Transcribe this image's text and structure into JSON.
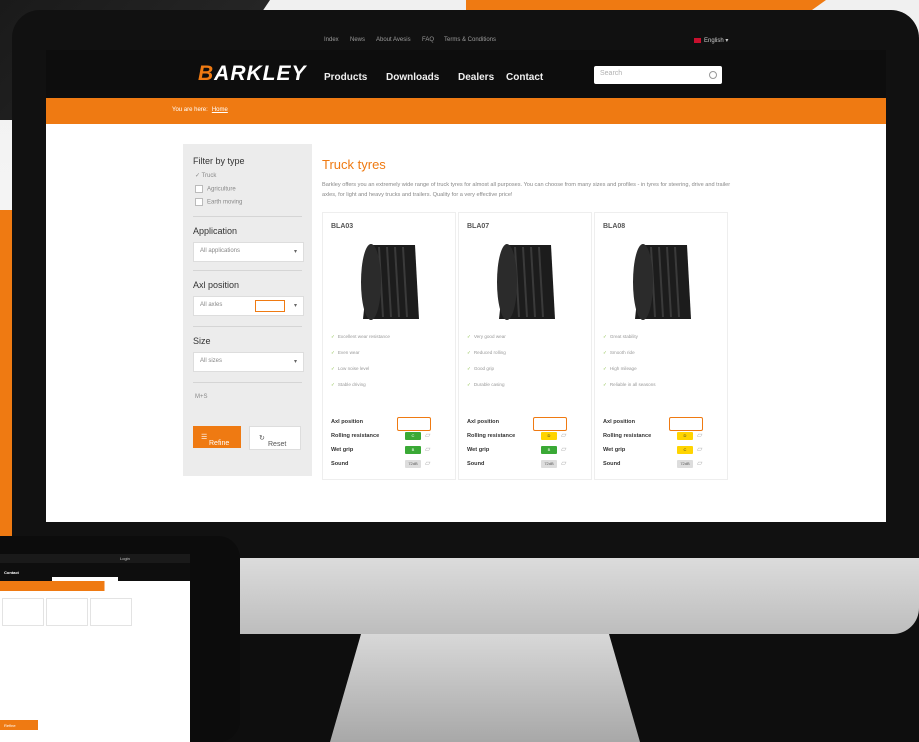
{
  "topbar": {
    "links": [
      "Index",
      "News",
      "About Avesis",
      "FAQ",
      "Terms & Conditions"
    ],
    "language": "English"
  },
  "header": {
    "logo_first": "B",
    "logo_rest": "ARKLEY",
    "nav": [
      "Products",
      "Downloads",
      "Dealers",
      "Contact"
    ],
    "search_placeholder": "Search"
  },
  "breadcrumb": {
    "prefix": "You are here:",
    "current": "Home"
  },
  "sidebar": {
    "filter_heading": "Filter by type",
    "types": [
      "Truck",
      "Agriculture",
      "Earth moving"
    ],
    "application_heading": "Application",
    "application_value": "All applications",
    "axle_heading": "Axl position",
    "axle_value": "All axles",
    "size_heading": "Size",
    "size_value": "All sizes",
    "extra_label": "M+S",
    "refine_label": "Refine",
    "reset_label": "Reset"
  },
  "content": {
    "title": "Truck tyres",
    "intro": "Barkley offers you an extremely wide range of truck tyres for almost all purposes. You can choose from many sizes and profiles - in tyres for steering, drive and trailer axles, for light and heavy trucks and trailers. Quality for a very effective price!"
  },
  "cards": [
    {
      "name": "BLA03",
      "bullets": [
        "Excellent wear resistance",
        "Even wear",
        "Low noise level",
        "Stable driving"
      ],
      "specs": {
        "axle": "Axl position",
        "rolling": "Rolling resistance",
        "wet": "Wet grip",
        "sound": "Sound"
      },
      "badges": {
        "rolling": "C",
        "wet": "B",
        "sound": "72dB"
      }
    },
    {
      "name": "BLA07",
      "bullets": [
        "Very good wear",
        "Reduced rolling",
        "Good grip",
        "Durable casing"
      ],
      "specs": {
        "axle": "Axl position",
        "rolling": "Rolling resistance",
        "wet": "Wet grip",
        "sound": "Sound"
      },
      "badges": {
        "rolling": "D",
        "wet": "B",
        "sound": "72dB"
      }
    },
    {
      "name": "BLA08",
      "bullets": [
        "Great stability",
        "Smooth ride",
        "High mileage",
        "Reliable in all seasons"
      ],
      "specs": {
        "axle": "Axl position",
        "rolling": "Rolling resistance",
        "wet": "Wet grip",
        "sound": "Sound"
      },
      "badges": {
        "rolling": "D",
        "wet": "C",
        "sound": "72dB"
      }
    }
  ],
  "tablet": {
    "menu": "Contact",
    "lang": "Login",
    "refine": "Refine"
  },
  "colors": {
    "accent": "#ef7a12",
    "dark": "#0d0d0d",
    "panel": "#ececec"
  }
}
